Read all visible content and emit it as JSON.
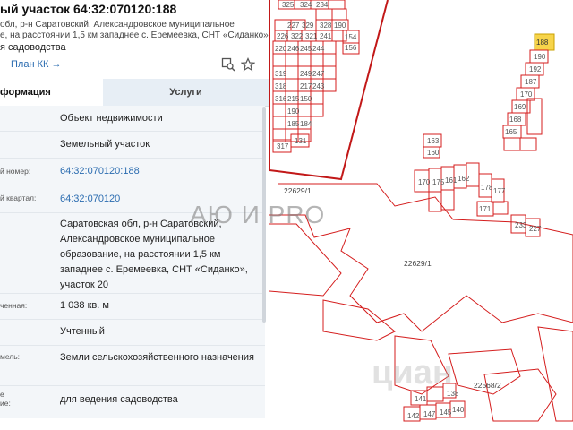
{
  "header": {
    "title": "ый участок 64:32:070120:188",
    "address_line1": "обл, р-н Саратовский, Александровское муниципальное",
    "address_line2": "е, на расстоянии 1,5 км западнее с. Еремеевка, СНТ «Сиданко»,...",
    "purpose": "я садоводства",
    "plan_link": "План КК →"
  },
  "tabs": {
    "info": "формация",
    "services": "Услуги"
  },
  "rows": [
    {
      "label": "",
      "value": "Объект недвижимости"
    },
    {
      "label": "",
      "value": "Земельный участок"
    },
    {
      "label": "й номер:",
      "value": "64:32:070120:188"
    },
    {
      "label": "й квартал:",
      "value": "64:32:070120"
    },
    {
      "label": "",
      "value": "Саратовская обл, р-н Саратовский, Александровское муниципальное образование, на расстоянии 1,5 км западнее с. Еремеевка, СНТ «Сиданко», участок 20"
    },
    {
      "label": "ченная:",
      "value": "1 038 кв. м"
    },
    {
      "label": "",
      "value": "Учтенный"
    },
    {
      "label": "мель:",
      "value": "Земли сельскохозяйственного назначения"
    },
    {
      "label": "е\nие:",
      "value": "для ведения садоводства"
    }
  ],
  "map": {
    "watermark": "АЮ И PRO",
    "watermark2": "циан",
    "labels": {
      "zone1": "22629/1",
      "zone2": "22629/1",
      "zone3": "22568/2",
      "selected": "188",
      "plots_left": [
        "325",
        "324",
        "234",
        "329",
        "227",
        "328",
        "190",
        "226",
        "322",
        "321",
        "241",
        "241",
        "220",
        "246",
        "245",
        "244",
        "319",
        "249",
        "247",
        "318",
        "217",
        "243",
        "316",
        "215",
        "150",
        "190",
        "185",
        "184",
        "317",
        "131",
        "154",
        "156",
        "156"
      ],
      "plots_right": [
        "190",
        "192",
        "187",
        "170",
        "169",
        "168",
        "165",
        "163",
        "160",
        "170",
        "175",
        "172",
        "161",
        "162",
        "178",
        "177",
        "176",
        "171",
        "233",
        "227",
        "186",
        "183",
        "141",
        "142",
        "147",
        "145",
        "140",
        "138"
      ]
    },
    "colors": {
      "line": "#d41c1c",
      "selected_fill": "#f7d44a"
    }
  }
}
